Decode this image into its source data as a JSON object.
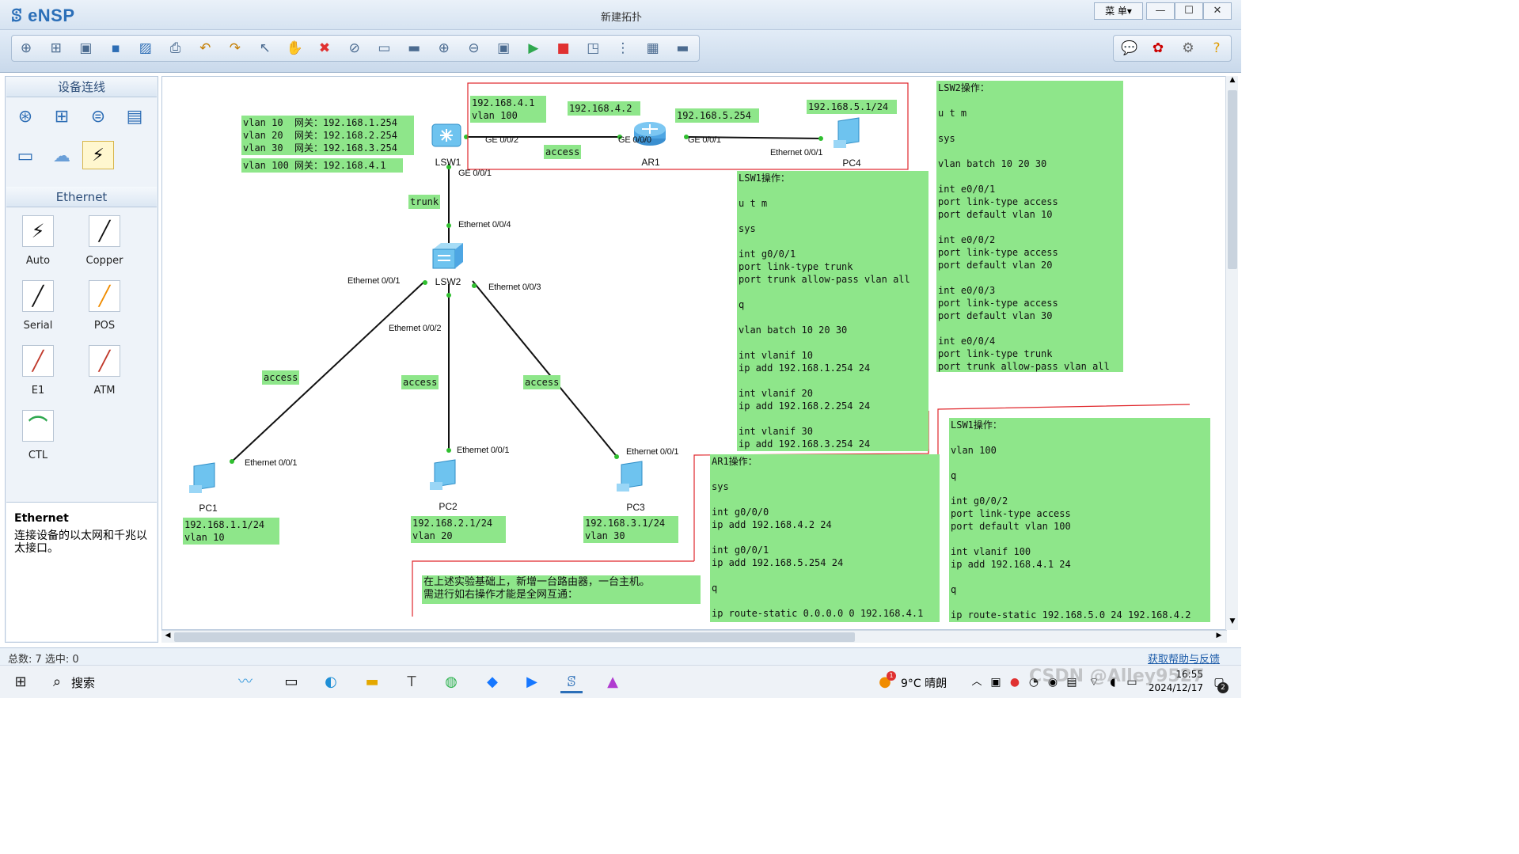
{
  "app": {
    "logo": "eNSP",
    "title": "新建拓扑",
    "menu": "菜 单▾",
    "min": "—",
    "max": "☐",
    "close": "✕"
  },
  "toolbar_icons": [
    "new-topo-icon",
    "new-example-icon",
    "open-icon",
    "save-icon",
    "save-as-icon",
    "print-icon",
    "undo-icon",
    "redo-icon",
    "select-icon",
    "pan-icon",
    "delete-icon",
    "delete-links-icon",
    "text-icon",
    "rect-icon",
    "zoom-in-icon",
    "zoom-out-icon",
    "fit-icon",
    "start-icon",
    "stop-icon",
    "capture-icon",
    "topo-icon",
    "grid-icon",
    "terminal-icon"
  ],
  "left": {
    "section1": "设备连线",
    "section2": "Ethernet",
    "cables": [
      {
        "label": "Auto",
        "glyph": "⚡"
      },
      {
        "label": "Copper",
        "glyph": "╱"
      },
      {
        "label": "Serial",
        "glyph": "╱"
      },
      {
        "label": "POS",
        "glyph": "╱"
      },
      {
        "label": "E1",
        "glyph": "╱"
      },
      {
        "label": "ATM",
        "glyph": "╱"
      },
      {
        "label": "CTL",
        "glyph": "⌒"
      }
    ],
    "info_title": "Ethernet",
    "info_desc": "连接设备的以太网和千兆以太接口。"
  },
  "topology": {
    "devices": {
      "lsw1": "LSW1",
      "lsw2": "LSW2",
      "ar1": "AR1",
      "pc1": "PC1",
      "pc2": "PC2",
      "pc3": "PC3",
      "pc4": "PC4"
    },
    "ports": {
      "lsw1_ge002": "GE 0/0/2",
      "lsw1_ge001": "GE 0/0/1",
      "ar1_ge000": "GE 0/0/0",
      "ar1_ge001": "GE 0/0/1",
      "pc4_eth": "Ethernet 0/0/1",
      "lsw2_e4": "Ethernet 0/0/4",
      "lsw2_e1": "Ethernet 0/0/1",
      "lsw2_e2": "Ethernet 0/0/2",
      "lsw2_e3": "Ethernet 0/0/3",
      "pc1_eth": "Ethernet 0/0/1",
      "pc2_eth": "Ethernet 0/0/1",
      "pc3_eth": "Ethernet 0/0/1"
    },
    "link_labels": {
      "trunk": "trunk",
      "access_ar": "access",
      "access_pc1": "access",
      "access_pc2": "access",
      "access_pc3": "access"
    }
  },
  "notes": {
    "gw": "vlan 10  网关：192.168.1.254\nvlan 20  网关：192.168.2.254\nvlan 30  网关：192.168.3.254",
    "gw100": "vlan 100 网关：192.168.4.1",
    "ip41": "192.168.4.1\nvlan 100",
    "ip42": "192.168.4.2",
    "ip5254": "192.168.5.254",
    "ip51": "192.168.5.1/24",
    "pc1": "192.168.1.1/24\nvlan 10",
    "pc2": "192.168.2.1/24\nvlan 20",
    "pc3": "192.168.3.1/24\nvlan 30",
    "lsw1": "LSW1操作：\n\nu t m\n\nsys\n\nint g0/0/1\nport link-type trunk\nport trunk allow-pass vlan all\n\nq\n\nvlan batch 10 20 30\n\nint vlanif 10\nip add 192.168.1.254 24\n\nint vlanif 20\nip add 192.168.2.254 24\n\nint vlanif 30\nip add 192.168.3.254 24",
    "lsw2": "LSW2操作：\n\nu t m\n\nsys\n\nvlan batch 10 20 30\n\nint e0/0/1\nport link-type access\nport default vlan 10\n\nint e0/0/2\nport link-type access\nport default vlan 20\n\nint e0/0/3\nport link-type access\nport default vlan 30\n\nint e0/0/4\nport link-type trunk\nport trunk allow-pass vlan all",
    "ar1": "AR1操作：\n\nsys\n\nint g0/0/0\nip add 192.168.4.2 24\n\nint g0/0/1\nip add 192.168.5.254 24\n\nq\n\nip route-static 0.0.0.0 0 192.168.4.1",
    "lsw1b": "LSW1操作：\n\nvlan 100\n\nq\n\nint g0/0/2\nport link-type access\nport default vlan 100\n\nint vlanif 100\nip add 192.168.4.1 24\n\nq\n\nip route-static 192.168.5.0 24 192.168.4.2",
    "task": "在上述实验基础上，新增一台路由器，一台主机。\n需进行如右操作才能是全网互通："
  },
  "status": {
    "left": "总数: 7 选中: 0",
    "help": "获取帮助与反馈"
  },
  "taskbar": {
    "search": "搜索",
    "weather": "9°C 晴朗",
    "time": "16:55",
    "date": "2024/12/17",
    "watermark": "CSDN @Alley9527",
    "badge": "2",
    "weather_badge": "1"
  }
}
